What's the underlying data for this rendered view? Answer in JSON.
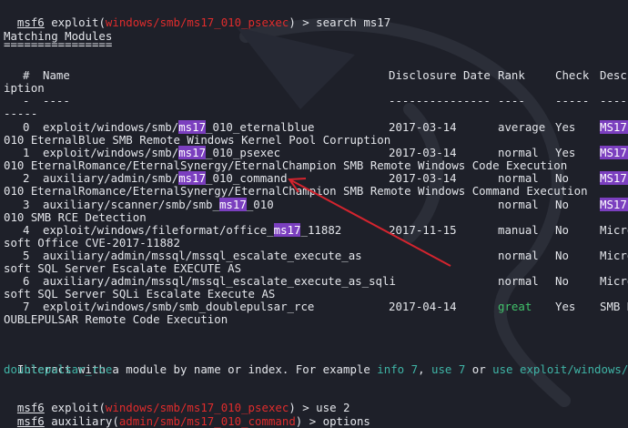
{
  "colors": {
    "background": "#1e2029",
    "text": "#e3e5ea",
    "red": "#e02c2c",
    "green": "#41c26b",
    "teal": "#3fb4a6",
    "highlight": "#7b3fbf",
    "arrow": "#d4242e"
  },
  "prompt1": {
    "msf": "msf6",
    "exploit": " exploit(",
    "module": "windows/smb/ms17_010_psexec",
    "close": ") > ",
    "command": "search ms17"
  },
  "matching_title": "Matching Modules",
  "matching_underline": "================",
  "headers": {
    "num": "#",
    "name": "Name",
    "date": "Disclosure Date",
    "rank": "Rank",
    "check": "Check",
    "desc": "Descr",
    "wrap": "iption",
    "num_dash": "-",
    "name_dash": "----",
    "date_dash": "---------------",
    "rank_dash": "----",
    "check_dash": "-----",
    "desc_dash": "-----",
    "wrap_dash": "-----"
  },
  "rows": [
    {
      "num": "0",
      "pre": "exploit/windows/smb/",
      "hl": "ms17",
      "post": "_010_eternalblue",
      "date": "2017-03-14",
      "rank": "average",
      "check": "Yes",
      "desc": "MS17-",
      "desc_hl": true,
      "wrap": "010 EternalBlue SMB Remote Windows Kernel Pool Corruption"
    },
    {
      "num": "1",
      "pre": "exploit/windows/smb/",
      "hl": "ms17",
      "post": "_010_psexec",
      "date": "2017-03-14",
      "rank": "normal",
      "check": "Yes",
      "desc": "MS17-",
      "desc_hl": true,
      "wrap": "010 EternalRomance/EternalSynergy/EternalChampion SMB Remote Windows Code Execution"
    },
    {
      "num": "2",
      "pre": "auxiliary/admin/smb/",
      "hl": "ms17",
      "post": "_010_command",
      "date": "2017-03-14",
      "rank": "normal",
      "check": "No",
      "desc": "MS17-",
      "desc_hl": true,
      "wrap": "010 EternalRomance/EternalSynergy/EternalChampion SMB Remote Windows Command Execution"
    },
    {
      "num": "3",
      "pre": "auxiliary/scanner/smb/smb_",
      "hl": "ms17",
      "post": "_010",
      "date": "",
      "rank": "normal",
      "check": "No",
      "desc": "MS17-",
      "desc_hl": true,
      "wrap": "010 SMB RCE Detection"
    },
    {
      "num": "4",
      "pre": "exploit/windows/fileformat/office_",
      "hl": "ms17",
      "post": "_11882",
      "date": "2017-11-15",
      "rank": "manual",
      "check": "No",
      "desc": "Micro",
      "desc_hl": false,
      "wrap": "soft Office CVE-2017-11882"
    },
    {
      "num": "5",
      "pre": "auxiliary/admin/mssql/mssql_escalate_execute_as",
      "hl": "",
      "post": "",
      "date": "",
      "rank": "normal",
      "check": "No",
      "desc": "Micro",
      "desc_hl": false,
      "wrap": "soft SQL Server Escalate EXECUTE AS"
    },
    {
      "num": "6",
      "pre": "auxiliary/admin/mssql/mssql_escalate_execute_as_sqli",
      "hl": "",
      "post": "",
      "date": "",
      "rank": "normal",
      "check": "No",
      "desc": "Micro",
      "desc_hl": false,
      "wrap": "soft SQL Server SQLi Escalate Execute AS"
    },
    {
      "num": "7",
      "pre": "exploit/windows/smb/smb_doublepulsar_rce",
      "hl": "",
      "post": "",
      "date": "2017-04-14",
      "rank": "great",
      "check": "Yes",
      "desc": "SMB D",
      "desc_hl": false,
      "wrap": "OUBLEPULSAR Remote Code Execution",
      "rank_green": true
    }
  ],
  "interact": {
    "pre": "Interact with a module by name or index. For example ",
    "info": "info 7",
    "sep1": ", ",
    "use": "use 7",
    "or": " or ",
    "use_path": "use exploit/windows/smb/",
    "cont": "doublepulsar_rce"
  },
  "prompt2": {
    "msf": "msf6",
    "exploit": " exploit(",
    "module": "windows/smb/ms17_010_psexec",
    "close": ") > ",
    "command": "use 2"
  },
  "prompt3": {
    "msf": "msf6",
    "aux": " auxiliary(",
    "module": "admin/smb/ms17_010_command",
    "close": ") > ",
    "command": "options"
  }
}
